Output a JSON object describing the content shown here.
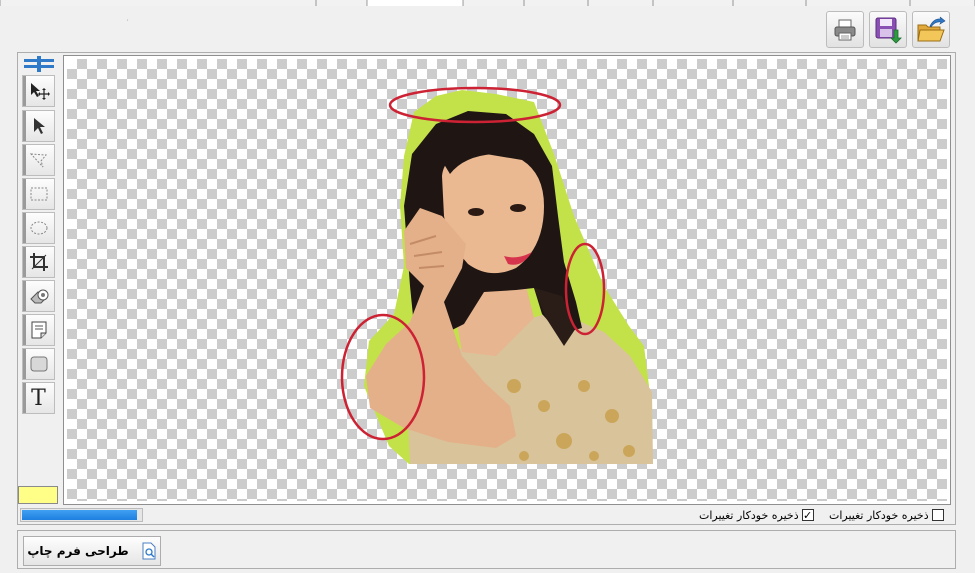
{
  "toolbar": {
    "faint_text": "،",
    "print_icon": "printer-icon",
    "save_icon": "save-download-icon",
    "open_icon": "open-folder-icon"
  },
  "toolbox": {
    "tools": [
      "move-tool-icon",
      "pointer-tool-icon",
      "lasso-tool-icon",
      "rect-select-icon",
      "ellipse-select-icon",
      "crop-icon",
      "eraser-icon",
      "note-icon",
      "rounded-rect-icon",
      "text-tool-icon"
    ],
    "text_tool_glyph": "T",
    "color": "#ffff88"
  },
  "canvas": {
    "image_desc_icon": "photo-image-icon",
    "annotation_color": "#cc2233",
    "fringe_color": "#c3e24a"
  },
  "status": {
    "progress_fraction": 0.125,
    "autosave_1_label": "ذخیره خودکار تغییرات",
    "autosave_1_checked": true,
    "autosave_2_label": "ذخیره خودکار تغییرات",
    "autosave_2_checked": false,
    "checkmark": "✓"
  },
  "footer": {
    "print_design_label": "طراحی فرم چاپ"
  }
}
